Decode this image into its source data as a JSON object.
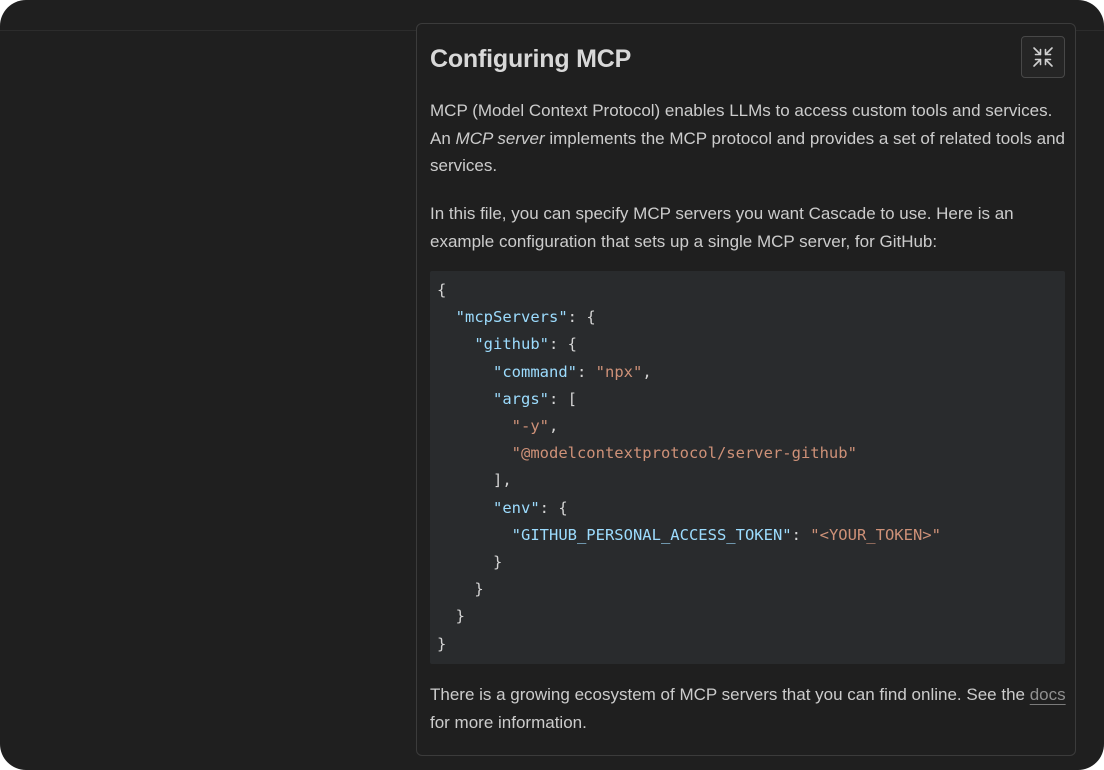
{
  "panel": {
    "title": "Configuring MCP",
    "collapse_icon": "collapse-arrows-icon",
    "intro_1_part1": "MCP (Model Context Protocol) enables LLMs to access custom tools and services. An ",
    "intro_1_emphasis": "MCP server",
    "intro_1_part2": " implements the MCP protocol and provides a set of related tools and services.",
    "intro_2": "In this file, you can specify MCP servers you want Cascade to use. Here is an example configuration that sets up a single MCP server, for GitHub:",
    "footer_part1": "There is a growing ecosystem of MCP servers that you can find online. See the ",
    "footer_link": "docs",
    "footer_part2": " for more information."
  },
  "code": {
    "lines": [
      [
        {
          "t": "punc",
          "v": "{"
        }
      ],
      [
        {
          "t": "punc",
          "v": "  "
        },
        {
          "t": "key",
          "v": "\"mcpServers\""
        },
        {
          "t": "punc",
          "v": ": {"
        }
      ],
      [
        {
          "t": "punc",
          "v": "    "
        },
        {
          "t": "key",
          "v": "\"github\""
        },
        {
          "t": "punc",
          "v": ": {"
        }
      ],
      [
        {
          "t": "punc",
          "v": "      "
        },
        {
          "t": "key",
          "v": "\"command\""
        },
        {
          "t": "punc",
          "v": ": "
        },
        {
          "t": "str",
          "v": "\"npx\""
        },
        {
          "t": "punc",
          "v": ","
        }
      ],
      [
        {
          "t": "punc",
          "v": "      "
        },
        {
          "t": "key",
          "v": "\"args\""
        },
        {
          "t": "punc",
          "v": ": ["
        }
      ],
      [
        {
          "t": "punc",
          "v": "        "
        },
        {
          "t": "str",
          "v": "\"-y\""
        },
        {
          "t": "punc",
          "v": ","
        }
      ],
      [
        {
          "t": "punc",
          "v": "        "
        },
        {
          "t": "str",
          "v": "\"@modelcontextprotocol/server-github\""
        }
      ],
      [
        {
          "t": "punc",
          "v": "      ],"
        }
      ],
      [
        {
          "t": "punc",
          "v": "      "
        },
        {
          "t": "key",
          "v": "\"env\""
        },
        {
          "t": "punc",
          "v": ": {"
        }
      ],
      [
        {
          "t": "punc",
          "v": "        "
        },
        {
          "t": "key",
          "v": "\"GITHUB_PERSONAL_ACCESS_TOKEN\""
        },
        {
          "t": "punc",
          "v": ": "
        },
        {
          "t": "str",
          "v": "\"<YOUR_TOKEN>\""
        }
      ],
      [
        {
          "t": "punc",
          "v": "      }"
        }
      ],
      [
        {
          "t": "punc",
          "v": "    }"
        }
      ],
      [
        {
          "t": "punc",
          "v": "  }"
        }
      ],
      [
        {
          "t": "punc",
          "v": "}"
        }
      ]
    ]
  },
  "colors": {
    "background": "#1f1f1f",
    "code_background": "#292b2d",
    "json_key": "#9cdcfe",
    "json_string": "#ce9178",
    "text": "#cccccc",
    "title": "#d8d8d8"
  }
}
